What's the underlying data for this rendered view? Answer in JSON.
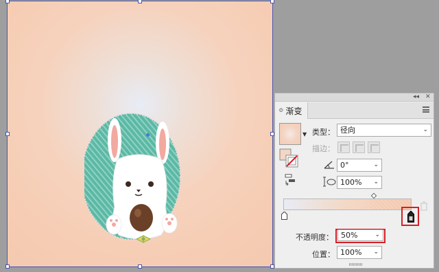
{
  "panel": {
    "collapse_glyph": "◂◂",
    "close_glyph": "✕",
    "tab_arrows": "≎",
    "tab_title": "渐变",
    "type_label": "类型：",
    "type_value": "径向",
    "stroke_label": "描边：",
    "angle_value": "0°",
    "aspect_value": "100%",
    "opacity_label": "不透明度：",
    "opacity_value": "50%",
    "location_label": "位置：",
    "location_value": "100%"
  },
  "colors": {
    "highlight": "#d42026",
    "selection": "#4a55b0",
    "canvas_bg": "#f6cdb4"
  },
  "icons": [
    "gradient-swatch-icon",
    "fill-stroke-swap-icon",
    "reverse-gradient-icon",
    "angle-icon",
    "aspect-ratio-icon",
    "color-stop-icon",
    "delete-stop-icon",
    "panel-menu-icon"
  ]
}
